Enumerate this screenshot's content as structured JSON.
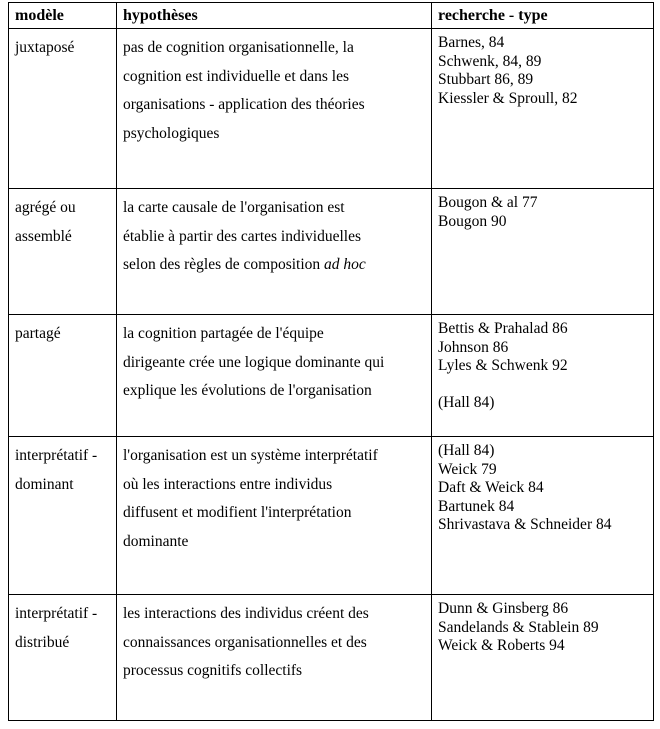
{
  "table": {
    "headers": [
      {
        "label": "modèle"
      },
      {
        "label": "hypothèses"
      },
      {
        "label": "recherche - type"
      }
    ],
    "rows": [
      {
        "model": "juxtaposé",
        "hypothesis_lines": [
          "pas de cognition organisationnelle, la",
          "cognition est individuelle et dans les",
          "organisations - application des théories",
          "psychologiques"
        ],
        "hypothesis_text": "pas de cognition organisationnelle, la cognition est individuelle et dans les organisations - application des théories psychologiques",
        "research_lines": [
          "Barnes, 84",
          "Schwenk, 84, 89",
          "Stubbart 86, 89",
          "Kiessler & Sproull, 82"
        ]
      },
      {
        "model_lines": [
          "agrégé ou",
          "assemblé"
        ],
        "model": "agrégé ou assemblé",
        "hypothesis_lines": [
          "la carte causale de l'organisation est",
          "établie à partir des cartes individuelles",
          "selon des règles de composition "
        ],
        "hypothesis_italic_tail": "ad hoc",
        "hypothesis_text": "la carte causale de l'organisation est établie à partir des cartes individuelles selon des règles de composition ad hoc",
        "research_lines": [
          "Bougon & al 77",
          "Bougon 90"
        ]
      },
      {
        "model": "partagé",
        "hypothesis_lines": [
          "la cognition partagée de l'équipe",
          "dirigeante crée une logique dominante qui",
          "explique les évolutions de l'organisation"
        ],
        "hypothesis_text": "la cognition partagée de l'équipe dirigeante crée une logique dominante qui explique les évolutions de l'organisation",
        "research_lines": [
          "Bettis & Prahalad 86",
          "Johnson 86",
          "Lyles & Schwenk 92",
          "",
          "(Hall 84)"
        ]
      },
      {
        "model_lines": [
          "interprétatif -",
          "dominant"
        ],
        "model": "interprétatif - dominant",
        "hypothesis_lines": [
          "l'organisation est un système interprétatif",
          "où les interactions entre individus",
          "diffusent et modifient l'interprétation",
          "dominante"
        ],
        "hypothesis_text": "l'organisation est un système interprétatif où les interactions entre individus diffusent et modifient l'interprétation dominante",
        "research_lines": [
          "(Hall 84)",
          "Weick 79",
          "Daft & Weick 84",
          "Bartunek 84",
          "Shrivastava & Schneider 84"
        ]
      },
      {
        "model_lines": [
          "interprétatif -",
          "distribué"
        ],
        "model": "interprétatif - distribué",
        "hypothesis_lines": [
          "les interactions des individus créent des",
          "connaissances organisationnelles et des",
          "processus cognitifs collectifs"
        ],
        "hypothesis_text": "les interactions des individus créent des connaissances organisationnelles et des processus cognitifs collectifs",
        "research_lines": [
          "Dunn & Ginsberg 86",
          "Sandelands & Stablein 89",
          "Weick & Roberts 94"
        ]
      }
    ]
  },
  "colors": {
    "text": "#000000",
    "border": "#000000",
    "background": "#ffffff"
  }
}
